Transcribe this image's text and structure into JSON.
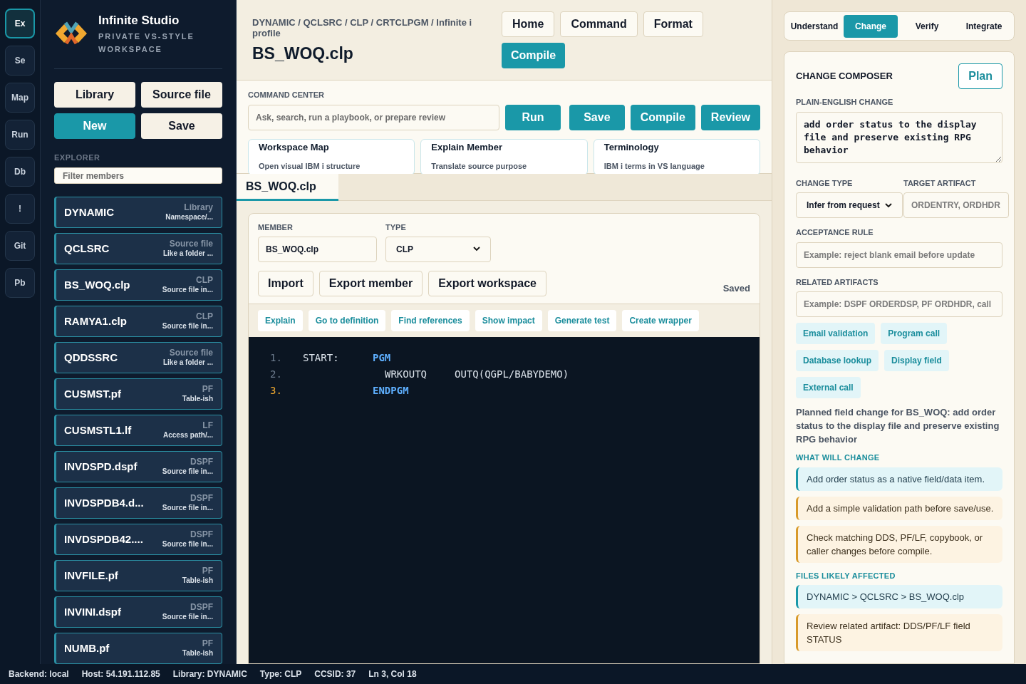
{
  "rail": [
    {
      "label": "Ex",
      "selected": true
    },
    {
      "label": "Se",
      "selected": false
    },
    {
      "label": "Map",
      "selected": false
    },
    {
      "label": "Run",
      "selected": false
    },
    {
      "label": "Db",
      "selected": false
    },
    {
      "label": "!",
      "selected": false
    },
    {
      "label": "Git",
      "selected": false
    },
    {
      "label": "Pb",
      "selected": false
    }
  ],
  "brand": {
    "title": "Infinite Studio",
    "subtitle": "PRIVATE VS-STYLE WORKSPACE"
  },
  "sidebar_buttons": [
    {
      "label": "Library",
      "primary": false
    },
    {
      "label": "Source file",
      "primary": false
    },
    {
      "label": "New",
      "primary": true
    },
    {
      "label": "Save",
      "primary": false
    }
  ],
  "explorer": {
    "heading": "EXPLORER",
    "filter_placeholder": "Filter members",
    "items": [
      {
        "name": "DYNAMIC",
        "type": "Library",
        "desc": "Namespace/..."
      },
      {
        "name": "QCLSRC",
        "type": "Source file",
        "desc": "Like a folder ..."
      },
      {
        "name": "BS_WOQ.clp",
        "type": "CLP",
        "desc": "Source file in..."
      },
      {
        "name": "RAMYA1.clp",
        "type": "CLP",
        "desc": "Source file in..."
      },
      {
        "name": "QDDSSRC",
        "type": "Source file",
        "desc": "Like a folder ..."
      },
      {
        "name": "CUSMST.pf",
        "type": "PF",
        "desc": "Table-ish"
      },
      {
        "name": "CUSMSTL1.lf",
        "type": "LF",
        "desc": "Access path/..."
      },
      {
        "name": "INVDSPD.dspf",
        "type": "DSPF",
        "desc": "Source file in..."
      },
      {
        "name": "INVDSPDB4.d...",
        "type": "DSPF",
        "desc": "Source file in..."
      },
      {
        "name": "INVDSPDB42....",
        "type": "DSPF",
        "desc": "Source file in..."
      },
      {
        "name": "INVFILE.pf",
        "type": "PF",
        "desc": "Table-ish"
      },
      {
        "name": "INVINI.dspf",
        "type": "DSPF",
        "desc": "Source file in..."
      },
      {
        "name": "NUMB.pf",
        "type": "PF",
        "desc": "Table-ish"
      }
    ]
  },
  "header": {
    "breadcrumb": "DYNAMIC / QCLSRC / CLP / CRTCLPGM / Infinite i profile",
    "title": "BS_WOQ.clp",
    "buttons": [
      {
        "label": "Home",
        "primary": false
      },
      {
        "label": "Command",
        "primary": false
      },
      {
        "label": "Format",
        "primary": false
      },
      {
        "label": "Compile",
        "primary": true
      }
    ]
  },
  "command_center": {
    "heading": "COMMAND CENTER",
    "placeholder": "Ask, search, run a playbook, or prepare review",
    "buttons": [
      "Run",
      "Save",
      "Compile",
      "Review"
    ],
    "cards": [
      {
        "title": "Workspace Map",
        "desc": "Open visual IBM i structure"
      },
      {
        "title": "Explain Member",
        "desc": "Translate source purpose"
      },
      {
        "title": "Terminology",
        "desc": "IBM i terms in VS language"
      }
    ]
  },
  "editor_tabs": [
    {
      "label": "BS_WOQ.clp",
      "selected": true
    }
  ],
  "member_form": {
    "member_label": "MEMBER",
    "member_value": "BS_WOQ.clp",
    "type_label": "TYPE",
    "type_value": "CLP",
    "buttons": [
      "Import",
      "Export member",
      "Export workspace"
    ],
    "status": "Saved"
  },
  "actions": [
    "Explain",
    "Go to definition",
    "Find references",
    "Show impact",
    "Generate test",
    "Create wrapper"
  ],
  "code_lines": [
    {
      "number": "1.",
      "current": false,
      "label": "START:",
      "command": "PGM",
      "kind": "keyword"
    },
    {
      "number": "2.",
      "current": false,
      "command": "WRKOUTQ",
      "kind": "plain",
      "params": "OUTQ(QGPL/BABYDEMO)"
    },
    {
      "number": "3.",
      "current": true,
      "command": "ENDPGM",
      "kind": "keyword"
    }
  ],
  "mode_tabs": [
    {
      "label": "Understand",
      "selected": false
    },
    {
      "label": "Change",
      "selected": true
    },
    {
      "label": "Verify",
      "selected": false
    },
    {
      "label": "Integrate",
      "selected": false
    }
  ],
  "composer": {
    "title": "CHANGE COMPOSER",
    "plan_button": "Plan",
    "change_label": "PLAIN-ENGLISH CHANGE",
    "change_value": "add order status to the display file and preserve existing RPG behavior",
    "type_label": "CHANGE TYPE",
    "type_value": "Infer from request",
    "target_label": "TARGET ARTIFACT",
    "target_placeholder": "ORDENTRY, ORDHDR",
    "acceptance_label": "ACCEPTANCE RULE",
    "acceptance_placeholder": "Example: reject blank email before update",
    "related_label": "RELATED ARTIFACTS",
    "related_placeholder": "Example: DSPF ORDERDSP, PF ORDHDR, call",
    "chips": [
      "Email validation",
      "Program call",
      "Database lookup",
      "Display field",
      "External call"
    ],
    "summary": "Planned field change for BS_WOQ: add order status to the display file and preserve existing RPG behavior",
    "changes_heading": "WHAT WILL CHANGE",
    "changes": [
      {
        "text": "Add order status as a native field/data item.",
        "kind": "info"
      },
      {
        "text": "Add a simple validation path before save/use.",
        "kind": "caution"
      },
      {
        "text": "Check matching DDS, PF/LF, copybook, or caller changes before compile.",
        "kind": "caution"
      }
    ],
    "files_heading": "FILES LIKELY AFFECTED",
    "files": [
      {
        "text": "DYNAMIC > QCLSRC > BS_WOQ.clp",
        "kind": "info"
      },
      {
        "text": "Review related artifact: DDS/PF/LF field STATUS",
        "kind": "caution"
      }
    ]
  },
  "status_bar": [
    "Backend: local",
    "Host: 54.191.112.85",
    "Library: DYNAMIC",
    "Type: CLP",
    "CCSID: 37",
    "Ln 3, Col 18"
  ]
}
